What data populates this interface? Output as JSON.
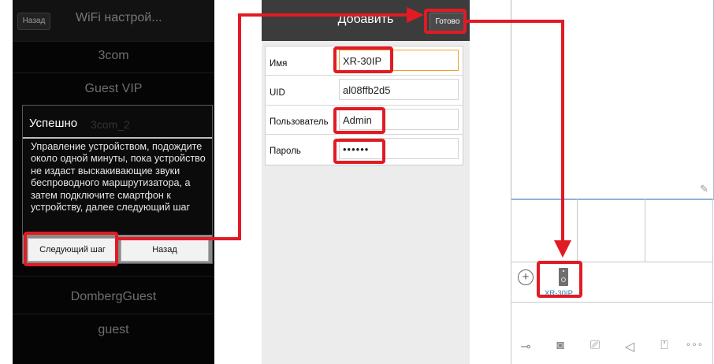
{
  "phone1": {
    "back_button": "Назад",
    "title": "WiFi настрой...",
    "networks": [
      "3com",
      "Guest VIP",
      "DombergGuest",
      "guest"
    ],
    "dialog": {
      "title": "Успешно",
      "hidden_network": "3com_2",
      "message": "Управление устройством, подождите около одной минуты, пока устройство не издаст выскакивающие звуки беспроводного маршрутизатора, а затем подключите смартфон к устройству, далее следующий шаг",
      "next_button": "Следующий шаг",
      "back_button": "Назад"
    }
  },
  "phone2": {
    "header_title": "Добавить",
    "done_button": "Готово",
    "fields": [
      {
        "label": "Имя",
        "value": "XR-30IP"
      },
      {
        "label": "UID",
        "value": "al08ffb2d5"
      },
      {
        "label": "Пользователь",
        "value": "Admin"
      },
      {
        "label": "Пароль",
        "value": "••••••"
      }
    ]
  },
  "phone3": {
    "device_label": "XR-30IP",
    "add_icon": "plus-circle-icon",
    "toolbar_icons": [
      "key-icon",
      "camera-icon",
      "video-record-icon",
      "speaker-icon",
      "microphone-icon",
      "more-icon"
    ],
    "toolbar_glyphs": [
      "⊸",
      "◙",
      "⎚",
      "◁",
      "⍞",
      "∘∘∘"
    ]
  },
  "colors": {
    "highlight": "#e11b24",
    "accent_blue": "#2a7bc0",
    "focus_orange": "#f0a030"
  }
}
